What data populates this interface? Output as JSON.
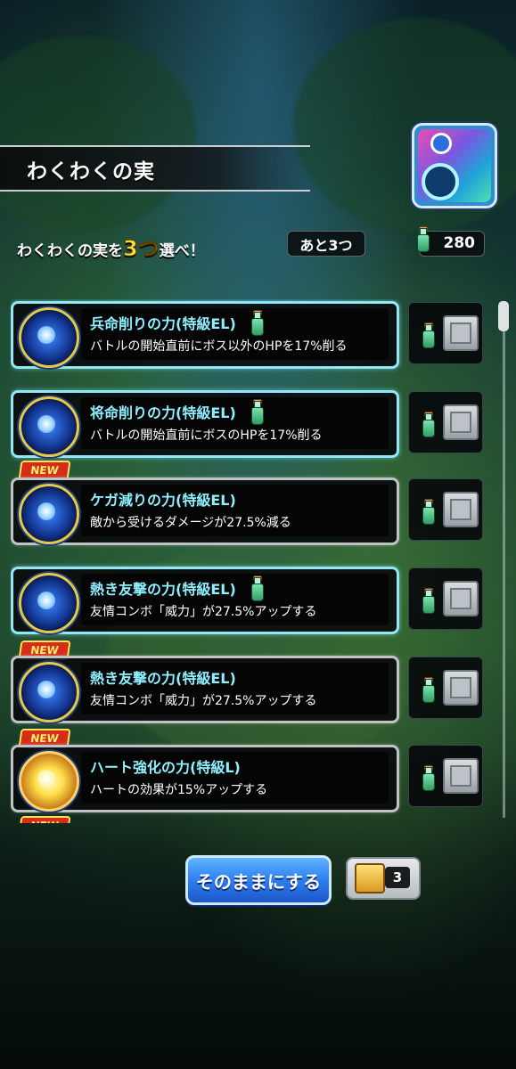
{
  "header": {
    "title": "わくわくの実"
  },
  "instruction": {
    "prefix": "わくわくの実を",
    "count": "3つ",
    "suffix": "選べ！"
  },
  "remaining": "あと3つ",
  "bottle_total": "280",
  "items": [
    {
      "name": "兵命削りの力(特級EL)",
      "desc": "バトルの開始直前にボス以外のHPを17%削る",
      "new": false,
      "bottle": true
    },
    {
      "name": "将命削りの力(特級EL)",
      "desc": "バトルの開始直前にボスのHPを17%削る",
      "new": false,
      "bottle": true
    },
    {
      "name": "ケガ減りの力(特級EL)",
      "desc": "敵から受けるダメージが27.5%減る",
      "new": true,
      "bottle": false
    },
    {
      "name": "熱き友撃の力(特級EL)",
      "desc": "友情コンボ「威力」が27.5%アップする",
      "new": false,
      "bottle": true
    },
    {
      "name": "熱き友撃の力(特級EL)",
      "desc": "友情コンボ「威力」が27.5%アップする",
      "new": true,
      "bottle": false
    },
    {
      "name": "ハート強化の力(特級L)",
      "desc": "ハートの効果が15%アップする",
      "new": true,
      "bottle": false
    }
  ],
  "new_label": "NEW",
  "footer": {
    "keep_button": "そのままにする",
    "scroll_count": "3"
  },
  "colors": {
    "accent_cyan": "#8ff0ff",
    "button_blue": "#2f7ef0",
    "new_red": "#d62c1a",
    "count_yellow": "#ffe23a"
  }
}
